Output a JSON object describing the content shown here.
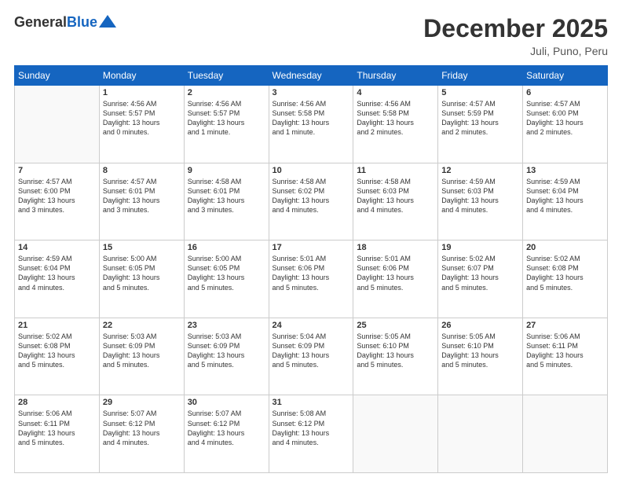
{
  "header": {
    "logo_general": "General",
    "logo_blue": "Blue",
    "title": "December 2025",
    "location": "Juli, Puno, Peru"
  },
  "days_of_week": [
    "Sunday",
    "Monday",
    "Tuesday",
    "Wednesday",
    "Thursday",
    "Friday",
    "Saturday"
  ],
  "weeks": [
    [
      {
        "day": "",
        "info": ""
      },
      {
        "day": "1",
        "info": "Sunrise: 4:56 AM\nSunset: 5:57 PM\nDaylight: 13 hours\nand 0 minutes."
      },
      {
        "day": "2",
        "info": "Sunrise: 4:56 AM\nSunset: 5:57 PM\nDaylight: 13 hours\nand 1 minute."
      },
      {
        "day": "3",
        "info": "Sunrise: 4:56 AM\nSunset: 5:58 PM\nDaylight: 13 hours\nand 1 minute."
      },
      {
        "day": "4",
        "info": "Sunrise: 4:56 AM\nSunset: 5:58 PM\nDaylight: 13 hours\nand 2 minutes."
      },
      {
        "day": "5",
        "info": "Sunrise: 4:57 AM\nSunset: 5:59 PM\nDaylight: 13 hours\nand 2 minutes."
      },
      {
        "day": "6",
        "info": "Sunrise: 4:57 AM\nSunset: 6:00 PM\nDaylight: 13 hours\nand 2 minutes."
      }
    ],
    [
      {
        "day": "7",
        "info": "Sunrise: 4:57 AM\nSunset: 6:00 PM\nDaylight: 13 hours\nand 3 minutes."
      },
      {
        "day": "8",
        "info": "Sunrise: 4:57 AM\nSunset: 6:01 PM\nDaylight: 13 hours\nand 3 minutes."
      },
      {
        "day": "9",
        "info": "Sunrise: 4:58 AM\nSunset: 6:01 PM\nDaylight: 13 hours\nand 3 minutes."
      },
      {
        "day": "10",
        "info": "Sunrise: 4:58 AM\nSunset: 6:02 PM\nDaylight: 13 hours\nand 4 minutes."
      },
      {
        "day": "11",
        "info": "Sunrise: 4:58 AM\nSunset: 6:03 PM\nDaylight: 13 hours\nand 4 minutes."
      },
      {
        "day": "12",
        "info": "Sunrise: 4:59 AM\nSunset: 6:03 PM\nDaylight: 13 hours\nand 4 minutes."
      },
      {
        "day": "13",
        "info": "Sunrise: 4:59 AM\nSunset: 6:04 PM\nDaylight: 13 hours\nand 4 minutes."
      }
    ],
    [
      {
        "day": "14",
        "info": "Sunrise: 4:59 AM\nSunset: 6:04 PM\nDaylight: 13 hours\nand 4 minutes."
      },
      {
        "day": "15",
        "info": "Sunrise: 5:00 AM\nSunset: 6:05 PM\nDaylight: 13 hours\nand 5 minutes."
      },
      {
        "day": "16",
        "info": "Sunrise: 5:00 AM\nSunset: 6:05 PM\nDaylight: 13 hours\nand 5 minutes."
      },
      {
        "day": "17",
        "info": "Sunrise: 5:01 AM\nSunset: 6:06 PM\nDaylight: 13 hours\nand 5 minutes."
      },
      {
        "day": "18",
        "info": "Sunrise: 5:01 AM\nSunset: 6:06 PM\nDaylight: 13 hours\nand 5 minutes."
      },
      {
        "day": "19",
        "info": "Sunrise: 5:02 AM\nSunset: 6:07 PM\nDaylight: 13 hours\nand 5 minutes."
      },
      {
        "day": "20",
        "info": "Sunrise: 5:02 AM\nSunset: 6:08 PM\nDaylight: 13 hours\nand 5 minutes."
      }
    ],
    [
      {
        "day": "21",
        "info": "Sunrise: 5:02 AM\nSunset: 6:08 PM\nDaylight: 13 hours\nand 5 minutes."
      },
      {
        "day": "22",
        "info": "Sunrise: 5:03 AM\nSunset: 6:09 PM\nDaylight: 13 hours\nand 5 minutes."
      },
      {
        "day": "23",
        "info": "Sunrise: 5:03 AM\nSunset: 6:09 PM\nDaylight: 13 hours\nand 5 minutes."
      },
      {
        "day": "24",
        "info": "Sunrise: 5:04 AM\nSunset: 6:09 PM\nDaylight: 13 hours\nand 5 minutes."
      },
      {
        "day": "25",
        "info": "Sunrise: 5:05 AM\nSunset: 6:10 PM\nDaylight: 13 hours\nand 5 minutes."
      },
      {
        "day": "26",
        "info": "Sunrise: 5:05 AM\nSunset: 6:10 PM\nDaylight: 13 hours\nand 5 minutes."
      },
      {
        "day": "27",
        "info": "Sunrise: 5:06 AM\nSunset: 6:11 PM\nDaylight: 13 hours\nand 5 minutes."
      }
    ],
    [
      {
        "day": "28",
        "info": "Sunrise: 5:06 AM\nSunset: 6:11 PM\nDaylight: 13 hours\nand 5 minutes."
      },
      {
        "day": "29",
        "info": "Sunrise: 5:07 AM\nSunset: 6:12 PM\nDaylight: 13 hours\nand 4 minutes."
      },
      {
        "day": "30",
        "info": "Sunrise: 5:07 AM\nSunset: 6:12 PM\nDaylight: 13 hours\nand 4 minutes."
      },
      {
        "day": "31",
        "info": "Sunrise: 5:08 AM\nSunset: 6:12 PM\nDaylight: 13 hours\nand 4 minutes."
      },
      {
        "day": "",
        "info": ""
      },
      {
        "day": "",
        "info": ""
      },
      {
        "day": "",
        "info": ""
      }
    ]
  ]
}
